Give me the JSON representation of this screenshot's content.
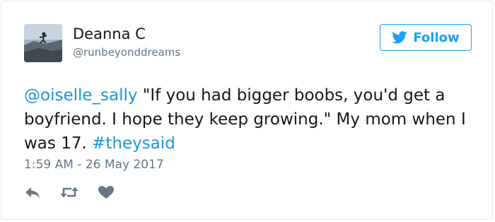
{
  "tweet": {
    "author": {
      "display_name": "Deanna C",
      "handle": "@runbeyonddreams",
      "avatar_icon": "runner-on-rock-avatar"
    },
    "follow_label": "Follow",
    "text_parts": [
      {
        "text": "@oiselle_sally",
        "link": true
      },
      {
        "text": " \"If you had bigger boobs, you'd get a boyfriend. I hope they keep growing.\" My mom when I was 17. ",
        "link": false
      },
      {
        "text": "#theysaid",
        "link": true
      }
    ],
    "timestamp": "1:59 AM - 26 May 2017",
    "actions": [
      "reply-icon",
      "retweet-icon",
      "like-icon"
    ]
  },
  "colors": {
    "accent": "#1da1f2",
    "link": "#1b95e0",
    "text": "#14171a",
    "muted": "#657786",
    "border": "#e1e8ed",
    "icon": "#657786"
  }
}
